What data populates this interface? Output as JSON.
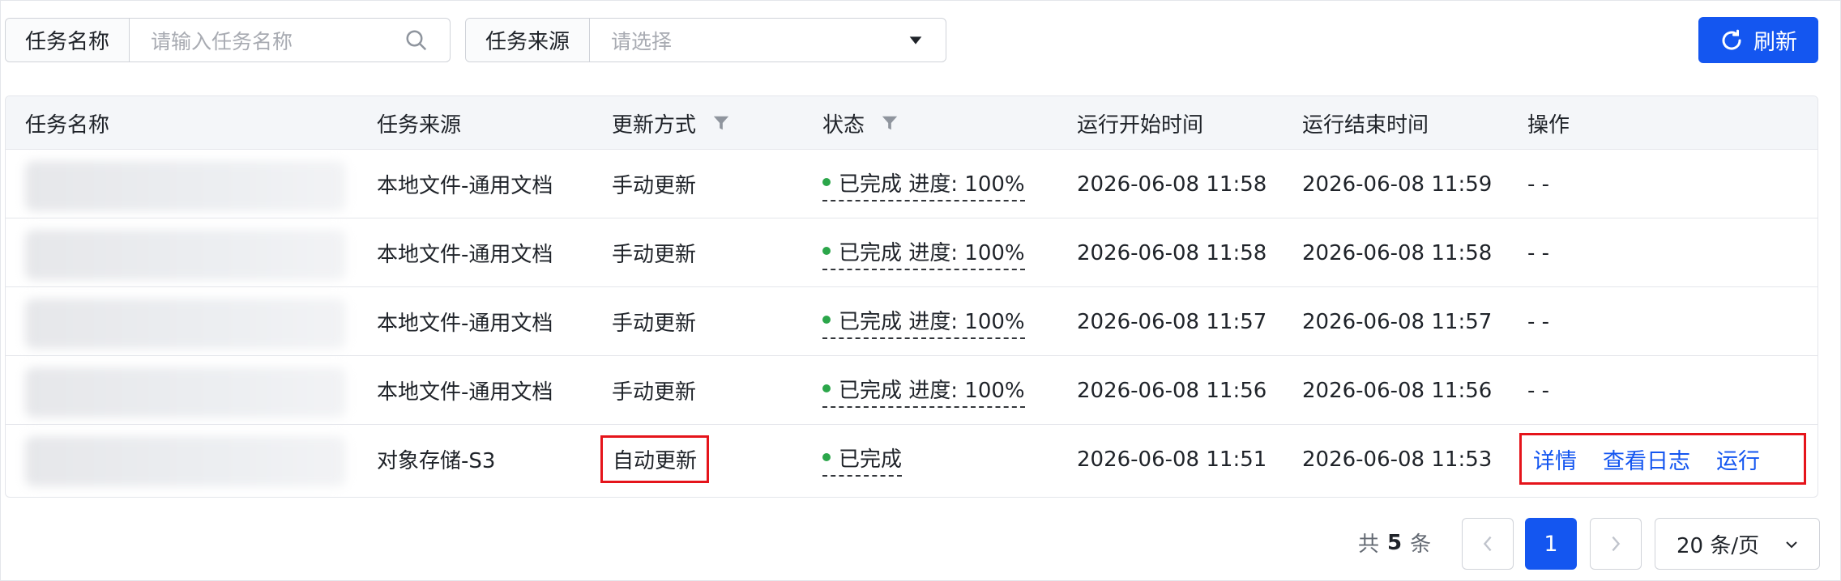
{
  "filters": {
    "task_name": {
      "label": "任务名称",
      "placeholder": "请输入任务名称"
    },
    "task_source": {
      "label": "任务来源",
      "placeholder": "请选择"
    }
  },
  "toolbar": {
    "refresh_label": "刷新"
  },
  "table": {
    "headers": {
      "task_name": "任务名称",
      "task_source": "任务来源",
      "update_mode": "更新方式",
      "status": "状态",
      "start_time": "运行开始时间",
      "end_time": "运行结束时间",
      "actions": "操作"
    },
    "rows": [
      {
        "source": "本地文件-通用文档",
        "mode": "手动更新",
        "status": "已完成 进度: 100%",
        "start": "2026-06-08 11:58",
        "end": "2026-06-08 11:59",
        "actions": "- -"
      },
      {
        "source": "本地文件-通用文档",
        "mode": "手动更新",
        "status": "已完成 进度: 100%",
        "start": "2026-06-08 11:58",
        "end": "2026-06-08 11:58",
        "actions": "- -"
      },
      {
        "source": "本地文件-通用文档",
        "mode": "手动更新",
        "status": "已完成 进度: 100%",
        "start": "2026-06-08 11:57",
        "end": "2026-06-08 11:57",
        "actions": "- -"
      },
      {
        "source": "本地文件-通用文档",
        "mode": "手动更新",
        "status": "已完成 进度: 100%",
        "start": "2026-06-08 11:56",
        "end": "2026-06-08 11:56",
        "actions": "- -"
      },
      {
        "source": "对象存储-S3",
        "mode": "自动更新",
        "status": "已完成",
        "start": "2026-06-08 11:51",
        "end": "2026-06-08 11:53",
        "links": {
          "detail": "详情",
          "logs": "查看日志",
          "run": "运行"
        }
      }
    ]
  },
  "pagination": {
    "total_prefix": "共",
    "total_count": "5",
    "total_suffix": "条",
    "current_page": "1",
    "page_size": "20 条/页"
  },
  "colors": {
    "primary": "#1456f0",
    "success": "#2ba64a",
    "highlight": "#e5141b"
  }
}
